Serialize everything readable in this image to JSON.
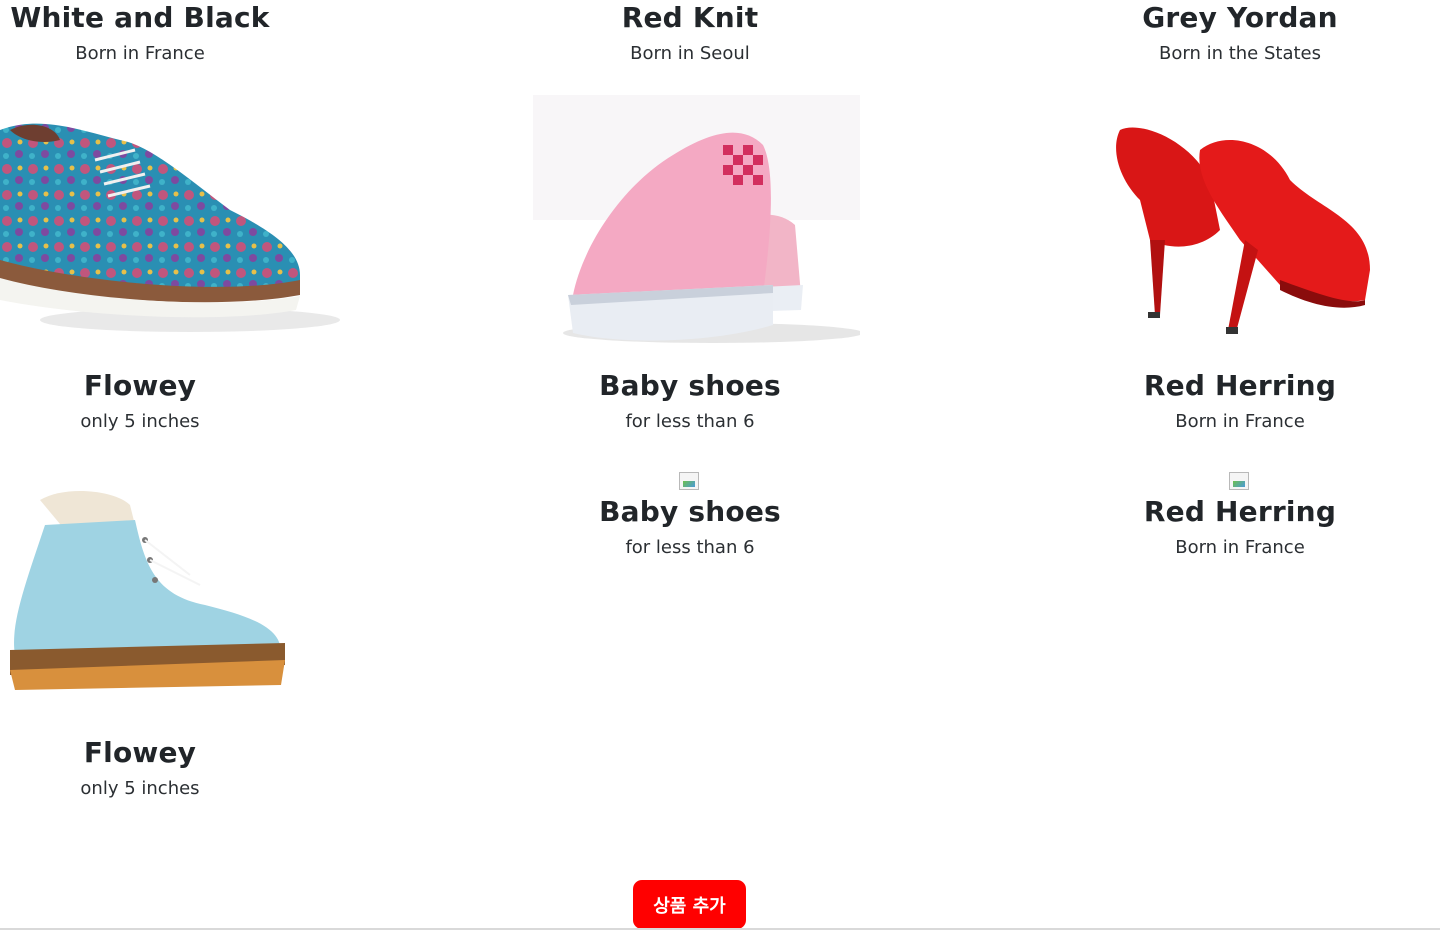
{
  "products": [
    {
      "title": "White and Black",
      "subtitle": "Born in France"
    },
    {
      "title": "Red Knit",
      "subtitle": "Born in Seoul"
    },
    {
      "title": "Grey Yordan",
      "subtitle": "Born in the States"
    },
    {
      "title": "Flowey",
      "subtitle": "only 5 inches"
    },
    {
      "title": "Baby shoes",
      "subtitle": "for less than 6"
    },
    {
      "title": "Red Herring",
      "subtitle": "Born in France"
    },
    {
      "title": "Flowey",
      "subtitle": "only 5 inches"
    },
    {
      "title": "Baby shoes",
      "subtitle": "for less than 6"
    },
    {
      "title": "Red Herring",
      "subtitle": "Born in France"
    }
  ],
  "add_button_label": "상품 추가",
  "colors": {
    "accent": "#ff0000",
    "text": "#212529"
  }
}
